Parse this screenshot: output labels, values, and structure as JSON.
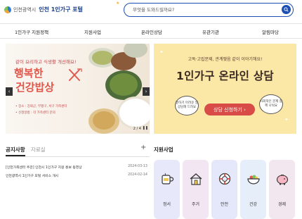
{
  "header": {
    "logo_text": "인천광역시",
    "portal_title": "인천 1인가구 포털",
    "search_placeholder": "무엇을 도와드릴까요?"
  },
  "nav": {
    "items": [
      "1인가구 지원정책",
      "지원사업",
      "온라인상담",
      "유관기관",
      "알림마당"
    ]
  },
  "banner_left": {
    "small_text": "같이 요리하고 식생활 개선해요!",
    "title_line1": "행복한",
    "title_line2": "건강밥상",
    "info": [
      "• 장소 : 강화군, 부평구, 서구 가족센터",
      "• 신청방법 : 각 가족센터 문의"
    ],
    "counter": "2 / 4",
    "prev_arrow": "‹",
    "next_arrow": "›"
  },
  "banner_right": {
    "subtitle": "고독·고립문제, 관계맺음 같이 이야기해요!",
    "title": "1인가구 온라인 상담",
    "bubble_left": "말하기 어려운 일 상담해 드려요",
    "bubble_right": "사회적인 문제 함께 나눠요",
    "button_label": "상담 신청하기 ›"
  },
  "notices": {
    "tab_active": "공지사항",
    "tab_inactive": "자료실",
    "plus": "+",
    "items": [
      {
        "title": "[인천가족센터 주관] 인천시 1인가구 지원 홍보 동영상",
        "date": "2024-03-13"
      },
      {
        "title": "인천광역시 1인가구 포털 서비스 개시",
        "date": "2024-02-14"
      }
    ]
  },
  "services": {
    "heading": "지원사업",
    "cards": [
      {
        "label": "정서",
        "icon": "coffee-cup-icon",
        "bg": "#e7e9fb"
      },
      {
        "label": "주거",
        "icon": "house-icon",
        "bg": "#f3e6f3"
      },
      {
        "label": "안전",
        "icon": "safety-ring-icon",
        "bg": "#e5e8fb"
      },
      {
        "label": "건강",
        "icon": "healthy-food-bowl-icon",
        "bg": "#e6eef9"
      },
      {
        "label": "경제",
        "icon": "piggy-bank-icon",
        "bg": "#f2e6ef"
      }
    ]
  },
  "colors": {
    "primary": "#1d4fb3",
    "banner_red": "#e0574b",
    "banner_yellow": "#fbe7a6",
    "button_red": "#d84b46"
  }
}
